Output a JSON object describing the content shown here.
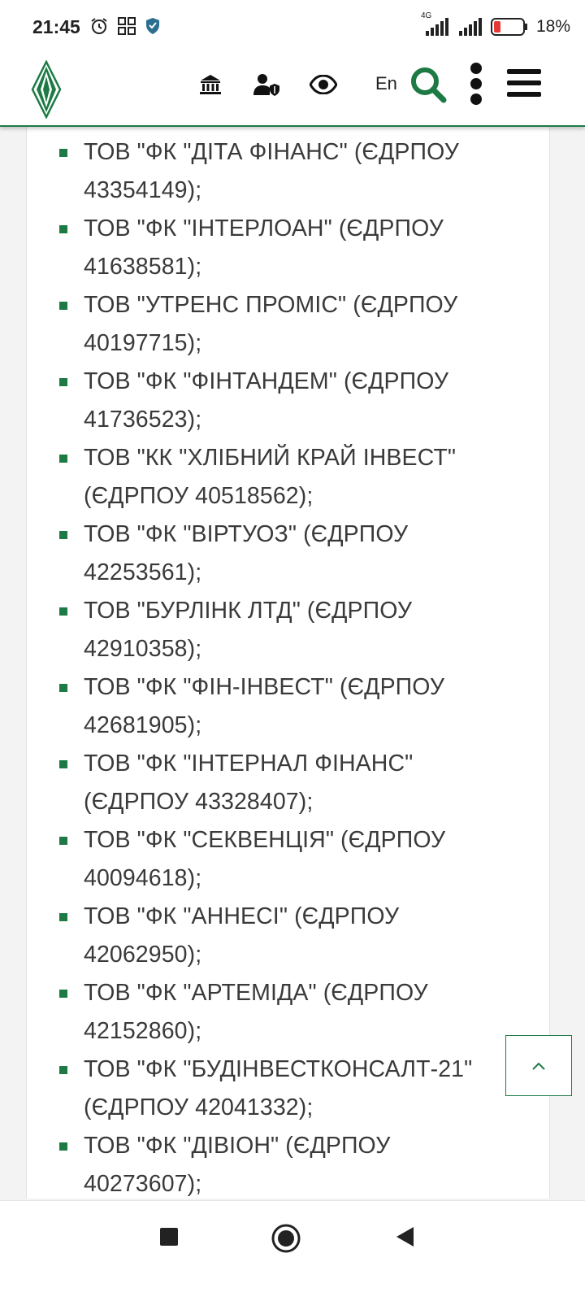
{
  "status_bar": {
    "time": "21:45",
    "network_label": "4G",
    "battery_percent": "18%",
    "icons": [
      "alarm-icon",
      "app-grid-icon",
      "shield-icon",
      "signal-icon",
      "signal-icon",
      "battery-icon"
    ]
  },
  "header": {
    "icons": [
      "institution-icon",
      "accessibility-user-icon",
      "eye-icon",
      "search-icon",
      "more-vertical-icon",
      "menu-icon"
    ],
    "lang_label": "En",
    "accent_color": "#1d7a45"
  },
  "companies": [
    {
      "line1": "ТОВ \"ФК \"ДІТА ФІНАНС\" (ЄДРПОУ",
      "line2": "43354149);"
    },
    {
      "line1": "ТОВ \"ФК \"ІНТЕРЛОАН\" (ЄДРПОУ",
      "line2": "41638581);"
    },
    {
      "line1": "ТОВ \"УТРЕНС ПРОМІС\" (ЄДРПОУ",
      "line2": "40197715);"
    },
    {
      "line1": "ТОВ \"ФК \"ФІНТАНДЕМ\" (ЄДРПОУ",
      "line2": "41736523);"
    },
    {
      "line1": "ТОВ \"КК \"ХЛІБНИЙ КРАЙ ІНВЕСТ\"",
      "line2": "(ЄДРПОУ 40518562);"
    },
    {
      "line1": "ТОВ \"ФК \"ВІРТУОЗ\" (ЄДРПОУ",
      "line2": "42253561);"
    },
    {
      "line1": "ТОВ \"БУРЛІНК ЛТД\" (ЄДРПОУ",
      "line2": "42910358);"
    },
    {
      "line1": "ТОВ \"ФК \"ФІН-ІНВЕСТ\" (ЄДРПОУ",
      "line2": "42681905);"
    },
    {
      "line1": "ТОВ \"ФК \"ІНТЕРНАЛ ФІНАНС\"",
      "line2": "(ЄДРПОУ 43328407);"
    },
    {
      "line1": "ТОВ \"ФК \"СЕКВЕНЦІЯ\" (ЄДРПОУ",
      "line2": "40094618);"
    },
    {
      "line1": "ТОВ \"ФК \"АННЕСІ\" (ЄДРПОУ",
      "line2": "42062950);"
    },
    {
      "line1": "ТОВ \"ФК \"АРТЕМІДА\" (ЄДРПОУ",
      "line2": "42152860);"
    },
    {
      "line1": "ТОВ \"ФК \"БУДІНВЕСТКОНСАЛТ-21\"",
      "line2": "(ЄДРПОУ 42041332);"
    },
    {
      "line1": "ТОВ \"ФК \"ДІВІОН\" (ЄДРПОУ",
      "line2": "40273607);"
    }
  ],
  "scroll_top": {
    "icon": "chevron-up-icon"
  },
  "nav_bar": {
    "icons": [
      "recents-square-icon",
      "home-circle-icon",
      "back-triangle-icon"
    ]
  }
}
